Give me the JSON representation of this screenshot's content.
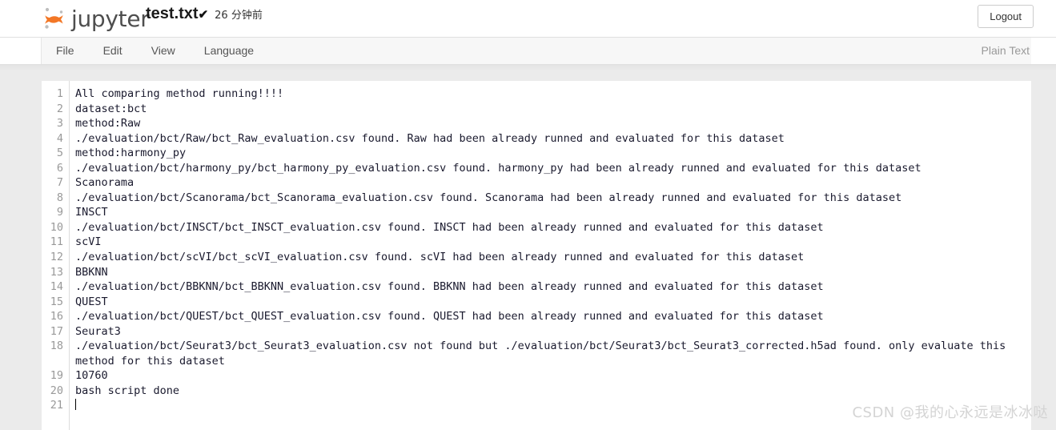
{
  "header": {
    "brand_name": "jupyter",
    "logo_icon": "jupyter-logo-icon",
    "file_name": "test.txt",
    "saved_check": "✔",
    "last_saved": "26 分钟前",
    "logout_label": "Logout"
  },
  "menubar": {
    "items": [
      {
        "label": "File"
      },
      {
        "label": "Edit"
      },
      {
        "label": "View"
      },
      {
        "label": "Language"
      }
    ],
    "mode_label": "Plain Text"
  },
  "editor": {
    "lines": [
      {
        "n": "1",
        "text": "All comparing method running!!!!",
        "wrap": false
      },
      {
        "n": "2",
        "text": "dataset:bct",
        "wrap": false
      },
      {
        "n": "3",
        "text": "method:Raw",
        "wrap": false
      },
      {
        "n": "4",
        "text": "./evaluation/bct/Raw/bct_Raw_evaluation.csv found. Raw had been already runned and evaluated for this dataset",
        "wrap": false
      },
      {
        "n": "5",
        "text": "method:harmony_py",
        "wrap": false
      },
      {
        "n": "6",
        "text": "./evaluation/bct/harmony_py/bct_harmony_py_evaluation.csv found. harmony_py had been already runned and evaluated for this dataset",
        "wrap": false
      },
      {
        "n": "7",
        "text": "Scanorama",
        "wrap": false
      },
      {
        "n": "8",
        "text": "./evaluation/bct/Scanorama/bct_Scanorama_evaluation.csv found. Scanorama had been already runned and evaluated for this dataset",
        "wrap": false
      },
      {
        "n": "9",
        "text": "INSCT",
        "wrap": false
      },
      {
        "n": "10",
        "text": "./evaluation/bct/INSCT/bct_INSCT_evaluation.csv found. INSCT had been already runned and evaluated for this dataset",
        "wrap": false
      },
      {
        "n": "11",
        "text": "scVI",
        "wrap": false
      },
      {
        "n": "12",
        "text": "./evaluation/bct/scVI/bct_scVI_evaluation.csv found. scVI had been already runned and evaluated for this dataset",
        "wrap": false
      },
      {
        "n": "13",
        "text": "BBKNN",
        "wrap": false
      },
      {
        "n": "14",
        "text": "./evaluation/bct/BBKNN/bct_BBKNN_evaluation.csv found. BBKNN had been already runned and evaluated for this dataset",
        "wrap": false
      },
      {
        "n": "15",
        "text": "QUEST",
        "wrap": false
      },
      {
        "n": "16",
        "text": "./evaluation/bct/QUEST/bct_QUEST_evaluation.csv found. QUEST had been already runned and evaluated for this dataset",
        "wrap": false
      },
      {
        "n": "17",
        "text": "Seurat3",
        "wrap": false
      },
      {
        "n": "18",
        "text": "./evaluation/bct/Seurat3/bct_Seurat3_evaluation.csv not found but ./evaluation/bct/Seurat3/bct_Seurat3_corrected.h5ad found. only evaluate this method for this dataset",
        "wrap": true
      },
      {
        "n": "19",
        "text": "10760",
        "wrap": false
      },
      {
        "n": "20",
        "text": "bash script done",
        "wrap": false
      },
      {
        "n": "21",
        "text": "",
        "wrap": false,
        "caret": true
      }
    ]
  },
  "watermark": {
    "text": "CSDN @我的心永远是冰冰哒"
  },
  "colors": {
    "brand_orange": "#f37726",
    "page_bg": "#ebebeb",
    "menubar_bg": "#f7f7f7",
    "code_text": "#1a1a2e",
    "gutter_text": "#999999"
  }
}
